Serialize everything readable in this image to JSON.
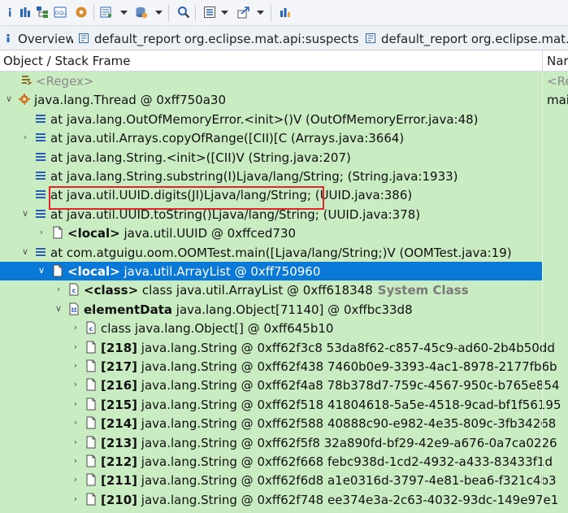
{
  "toolbar": {
    "buttons": [
      "info-icon",
      "histogram-icon",
      "dominator-tree-icon",
      "oql-icon",
      "heap-dump-overview-icon",
      "run-report-icon",
      "dropdown-icon",
      "query-browser-icon",
      "dropdown-icon",
      "search-icon",
      "group-by-icon",
      "dropdown-icon",
      "export-icon",
      "dropdown-icon",
      "calculate-retained-icon"
    ]
  },
  "tabs": [
    {
      "label": "Overview",
      "icon": "overview-icon"
    },
    {
      "label": "default_report  org.eclipse.mat.api:suspects",
      "icon": "report-icon"
    },
    {
      "label": "default_report  org.eclipse.mat.api:suspects",
      "icon": "report-icon"
    }
  ],
  "columns": {
    "object": "Object / Stack Frame",
    "name": "Nar"
  },
  "rows": [
    {
      "arrow": "",
      "icon": "regex-icon",
      "text": "<Regex>",
      "col2": "<Re",
      "style": "regex"
    },
    {
      "arrow": "down",
      "icon": "thread-icon",
      "text": "java.lang.Thread @ 0xff750a30",
      "col2": "mai"
    },
    {
      "arrow": "",
      "icon": "stack-frame-icon",
      "text": "at java.lang.OutOfMemoryError.<init>()V (OutOfMemoryError.java:48)",
      "col2": ""
    },
    {
      "arrow": "right",
      "icon": "stack-frame-icon",
      "text": "at java.util.Arrays.copyOfRange([CII)[C (Arrays.java:3664)",
      "col2": ""
    },
    {
      "arrow": "",
      "icon": "stack-frame-icon",
      "text": "at java.lang.String.<init>([CII)V (String.java:207)",
      "col2": ""
    },
    {
      "arrow": "",
      "icon": "stack-frame-icon",
      "text": "at java.lang.String.substring(I)Ljava/lang/String; (String.java:1933)",
      "col2": ""
    },
    {
      "arrow": "",
      "icon": "stack-frame-icon",
      "text": "at java.util.UUID.digits(JI)Ljava/lang/String; (UUID.java:386)",
      "col2": ""
    },
    {
      "arrow": "down",
      "icon": "stack-frame-icon",
      "text": "at java.util.UUID.toString()Ljava/lang/String; (UUID.java:378)",
      "col2": ""
    },
    {
      "arrow": "right",
      "icon": "local-object-icon",
      "bold": "<local>",
      "text": " java.util.UUID @ 0xffced730",
      "col2": ""
    },
    {
      "arrow": "down",
      "icon": "stack-frame-icon",
      "text": "at com.atguigu.oom.OOMTest.main([Ljava/lang/String;)V (OOMTest.java:19)",
      "col2": ""
    },
    {
      "arrow": "down",
      "icon": "local-object-icon",
      "bold": "<local>",
      "text": " java.util.ArrayList @ 0xff750960",
      "col2": "",
      "selected": true
    },
    {
      "arrow": "right",
      "icon": "class-object-icon",
      "bold": "<class>",
      "text": " class java.util.ArrayList @ 0xff618348",
      "sys": "System Class",
      "col2": ""
    },
    {
      "arrow": "down",
      "icon": "array-object-icon",
      "bold": "elementData",
      "text": " java.lang.Object[71140] @ 0xffbc33d8",
      "col2": ""
    },
    {
      "arrow": "right",
      "icon": "class-object-icon",
      "text": "class java.lang.Object[] @ 0xff645b10",
      "col2": ""
    },
    {
      "arrow": "right",
      "icon": "local-object-icon",
      "bold": "[218]",
      "text": " java.lang.String @ 0xff62f3c8  53da8f62-c857-45c9-ad60-2b4b50dd",
      "col2": ""
    },
    {
      "arrow": "right",
      "icon": "local-object-icon",
      "bold": "[217]",
      "text": " java.lang.String @ 0xff62f438  7460b0e9-3393-4ac1-8978-2177fb6b",
      "col2": ""
    },
    {
      "arrow": "right",
      "icon": "local-object-icon",
      "bold": "[216]",
      "text": " java.lang.String @ 0xff62f4a8  78b378d7-759c-4567-950c-b765e854",
      "col2": ""
    },
    {
      "arrow": "right",
      "icon": "local-object-icon",
      "bold": "[215]",
      "text": " java.lang.String @ 0xff62f518  41804618-5a5e-4518-9cad-bf1f56195",
      "col2": ""
    },
    {
      "arrow": "right",
      "icon": "local-object-icon",
      "bold": "[214]",
      "text": " java.lang.String @ 0xff62f588  40888c90-e982-4e35-809c-3fb34268",
      "col2": ""
    },
    {
      "arrow": "right",
      "icon": "local-object-icon",
      "bold": "[213]",
      "text": " java.lang.String @ 0xff62f5f8  32a890fd-bf29-42e9-a676-0a7ca0226",
      "col2": ""
    },
    {
      "arrow": "right",
      "icon": "local-object-icon",
      "bold": "[212]",
      "text": " java.lang.String @ 0xff62f668  febc938d-1cd2-4932-a433-83433f1d",
      "col2": ""
    },
    {
      "arrow": "right",
      "icon": "local-object-icon",
      "bold": "[211]",
      "text": " java.lang.String @ 0xff62f6d8  a1e0316d-3797-4e81-bea6-f321c4b3",
      "col2": ""
    },
    {
      "arrow": "right",
      "icon": "local-object-icon",
      "bold": "[210]",
      "text": " java.lang.String @ 0xff62f748  ee374e3a-2c63-4032-93dc-149e97e1",
      "col2": ""
    }
  ],
  "colors": {
    "tree_background": "#c9ecc2",
    "selection": "#0a78d7",
    "highlight_box": "#e0262b"
  }
}
